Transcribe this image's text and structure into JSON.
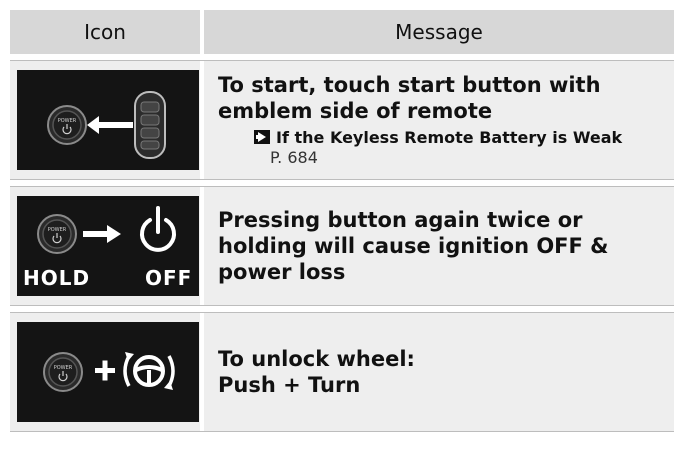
{
  "header": {
    "icon_label": "Icon",
    "message_label": "Message"
  },
  "rows": [
    {
      "icon": "power-button-remote-icon",
      "message": "To start, touch start button with emblem side of remote",
      "ref_text": "If the Keyless Remote Battery is Weak",
      "ref_page": "P. 684",
      "icon_text": "POWER"
    },
    {
      "icon": "hold-power-off-icon",
      "message": "Pressing button again twice or holding will cause ignition OFF & power loss",
      "icon_hold": "HOLD",
      "icon_off": "OFF",
      "icon_text": "POWER"
    },
    {
      "icon": "power-plus-steering-wheel-icon",
      "message_line1": "To unlock wheel:",
      "message_line2": "Push + Turn",
      "icon_text": "POWER"
    }
  ]
}
